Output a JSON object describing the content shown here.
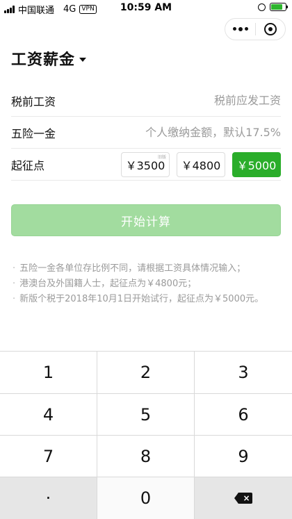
{
  "status_bar": {
    "carrier": "中国联通",
    "network": "4G",
    "vpn": "VPN",
    "time": "10:59 AM"
  },
  "capsule": {
    "more_icon": "more-dots-icon",
    "close_icon": "target-circle-icon"
  },
  "title": {
    "text": "工资薪金",
    "icon": "dropdown-caret-icon"
  },
  "form": {
    "salary": {
      "label": "税前工资",
      "placeholder": "税前应发工资"
    },
    "insurance": {
      "label": "五险一金",
      "placeholder": "个人缴纳金额，默认17.5%"
    },
    "threshold": {
      "label": "起征点",
      "options": [
        {
          "label": "￥3500",
          "mark": "旧版"
        },
        {
          "label": "￥4800"
        },
        {
          "label": "￥5000"
        }
      ],
      "selected": "￥5000"
    }
  },
  "start_button": "开始计算",
  "notes": {
    "items": [
      "五险一金各单位存比例不同，请根据工资具体情况输入；",
      "港澳台及外国籍人士，起征点为￥4800元；",
      "新版个税于2018年10月1日开始试行，起征点为￥5000元。"
    ]
  },
  "keypad": {
    "keys": [
      "1",
      "2",
      "3",
      "4",
      "5",
      "6",
      "7",
      "8",
      "9",
      "·",
      "0"
    ],
    "delete_icon": "backspace-icon"
  },
  "colors": {
    "accent": "#2aad2a",
    "button_disabled": "#a2dc9f",
    "hint": "#9a9a9a",
    "key_gray": "#e6e6e6"
  }
}
